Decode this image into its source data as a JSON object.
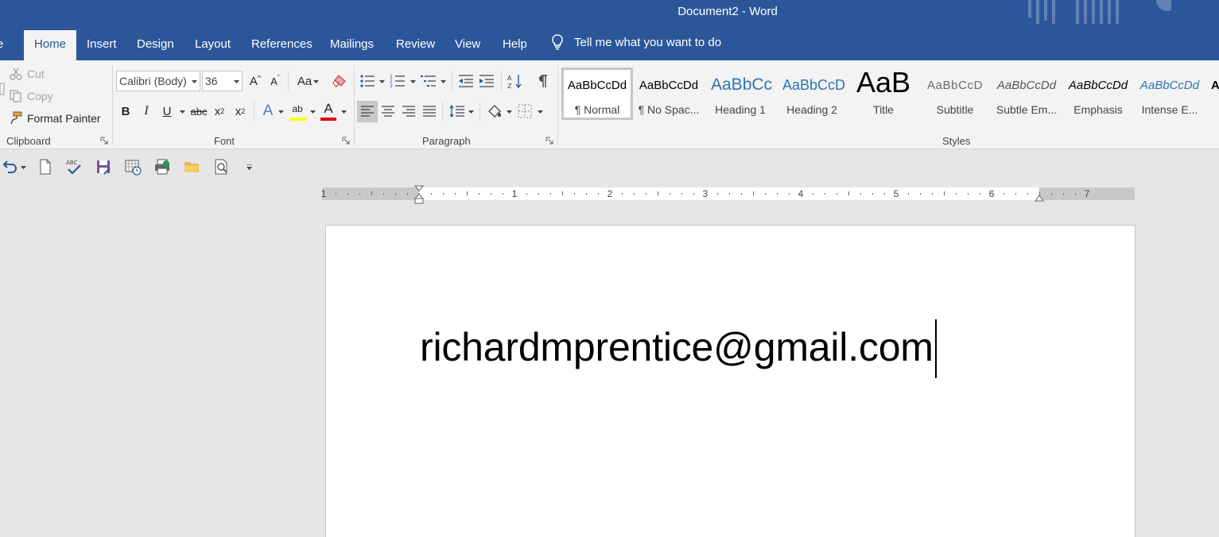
{
  "window": {
    "title": "Document2  -  Word"
  },
  "tabs": [
    {
      "id": "file",
      "label": "e"
    },
    {
      "id": "home",
      "label": "Home",
      "active": true
    },
    {
      "id": "insert",
      "label": "Insert"
    },
    {
      "id": "design",
      "label": "Design"
    },
    {
      "id": "layout",
      "label": "Layout"
    },
    {
      "id": "references",
      "label": "References"
    },
    {
      "id": "mailings",
      "label": "Mailings"
    },
    {
      "id": "review",
      "label": "Review"
    },
    {
      "id": "view",
      "label": "View"
    },
    {
      "id": "help",
      "label": "Help"
    }
  ],
  "tell_me": {
    "label": "Tell me what you want to do",
    "icon": "lightbulb-icon"
  },
  "clipboard": {
    "label": "Clipboard",
    "cut": "Cut",
    "copy": "Copy",
    "format_painter": "Format Painter"
  },
  "font": {
    "label": "Font",
    "name": "Calibri (Body)",
    "size": "36",
    "bold": "B",
    "italic": "I",
    "underline": "U",
    "strike": "abc",
    "subscript": "x",
    "subscript_mark": "2",
    "superscript": "x",
    "superscript_mark": "2",
    "change_case": "Aa",
    "grow": "A",
    "shrink": "A",
    "text_effects": "A",
    "highlight": "ab",
    "font_color": "A",
    "highlight_color": "#ffff00",
    "font_color_value": "#e00000"
  },
  "paragraph": {
    "label": "Paragraph"
  },
  "styles": {
    "label": "Styles",
    "items": [
      {
        "sample": "AaBbCcDd",
        "name": "¶ Normal",
        "selected": true
      },
      {
        "sample": "AaBbCcDd",
        "name": "¶ No Spac..."
      },
      {
        "sample": "AaBbCc",
        "name": "Heading 1"
      },
      {
        "sample": "AaBbCcD",
        "name": "Heading 2"
      },
      {
        "sample": "AaB",
        "name": "Title"
      },
      {
        "sample": "AaBbCcD",
        "name": "Subtitle"
      },
      {
        "sample": "AaBbCcDd",
        "name": "Subtle Em..."
      },
      {
        "sample": "AaBbCcDd",
        "name": "Emphasis"
      },
      {
        "sample": "AaBbCcDd",
        "name": "Intense E..."
      },
      {
        "sample": "A",
        "name": ""
      }
    ]
  },
  "ruler": {
    "numbers": [
      "1",
      "1",
      "2",
      "3",
      "4",
      "5",
      "6",
      "7"
    ]
  },
  "document": {
    "text": "richardmprentice@gmail.com"
  },
  "colors": {
    "brand": "#2b579a",
    "ribbon": "#f3f3f3",
    "canvas": "#e6e6e6"
  }
}
